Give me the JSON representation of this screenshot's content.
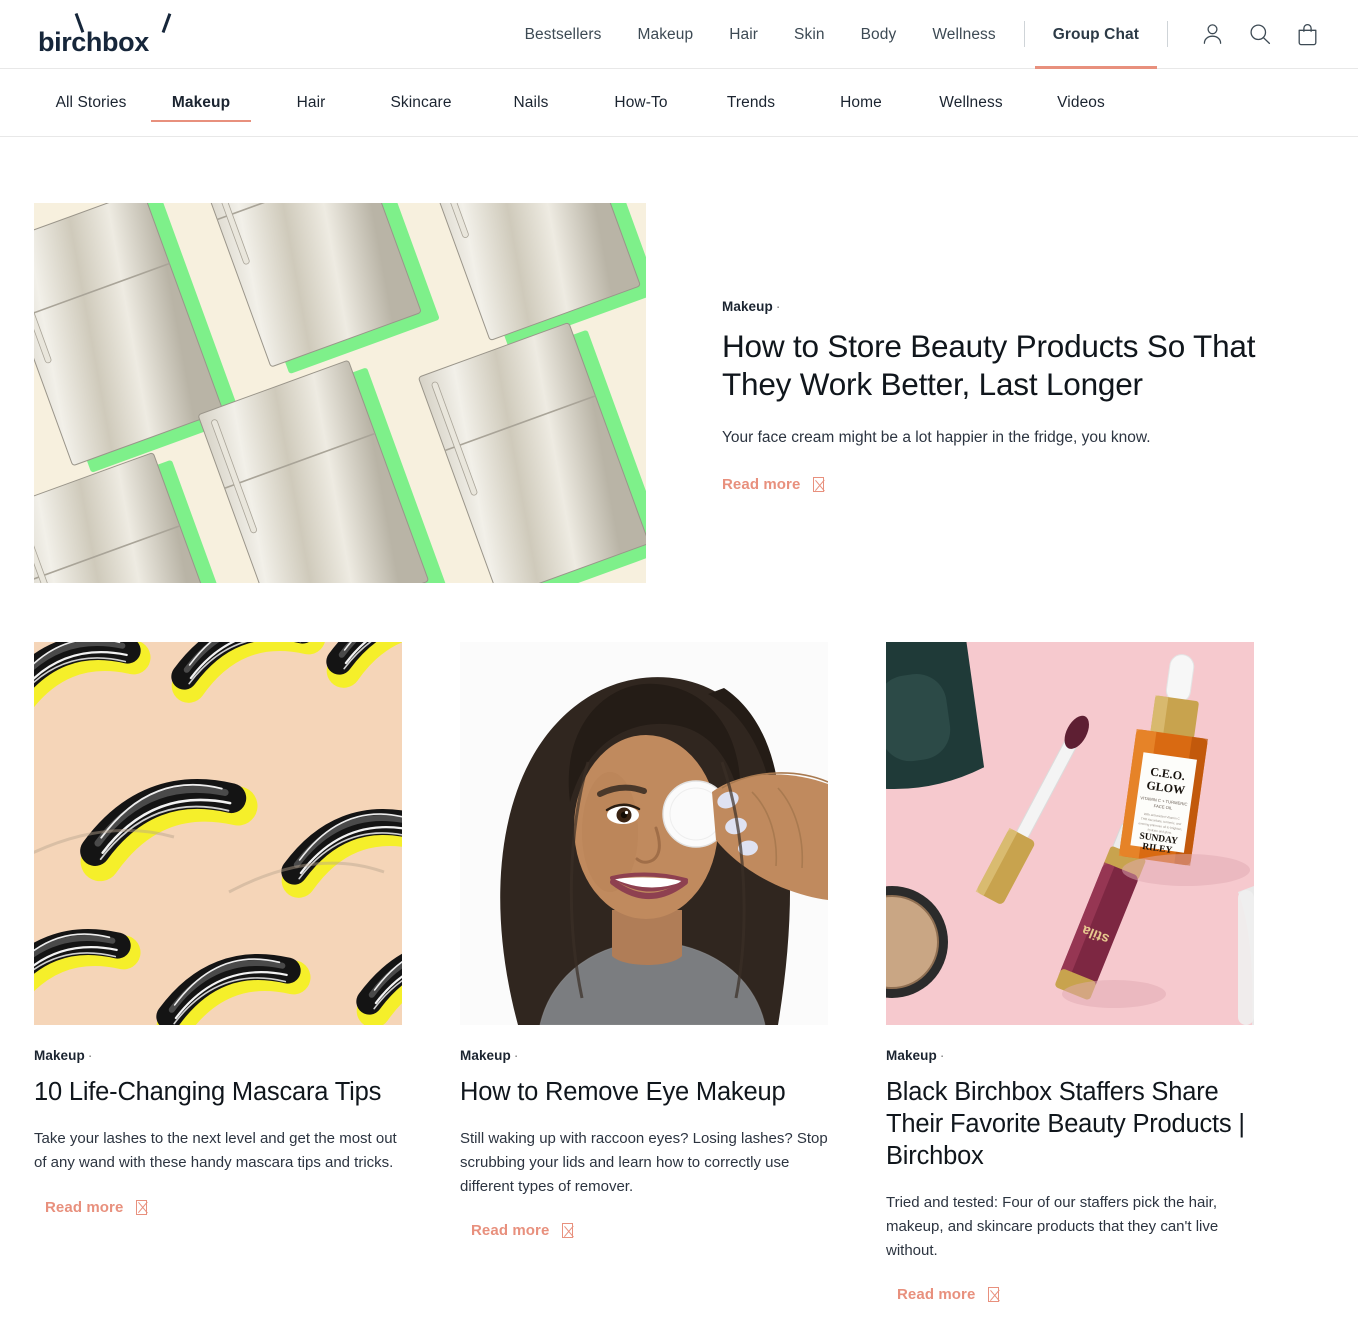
{
  "header": {
    "logo_text": "birchbox",
    "nav": [
      {
        "label": "Bestsellers",
        "active": false
      },
      {
        "label": "Makeup",
        "active": false
      },
      {
        "label": "Hair",
        "active": false
      },
      {
        "label": "Skin",
        "active": false
      },
      {
        "label": "Body",
        "active": false
      },
      {
        "label": "Wellness",
        "active": false
      },
      {
        "label": "Group Chat",
        "active": true
      }
    ],
    "icons": [
      "account-icon",
      "search-icon",
      "bag-icon"
    ]
  },
  "sub_nav": {
    "items": [
      {
        "label": "All Stories",
        "active": false
      },
      {
        "label": "Makeup",
        "active": true
      },
      {
        "label": "Hair",
        "active": false
      },
      {
        "label": "Skincare",
        "active": false
      },
      {
        "label": "Nails",
        "active": false
      },
      {
        "label": "How-To",
        "active": false
      },
      {
        "label": "Trends",
        "active": false
      },
      {
        "label": "Home",
        "active": false
      },
      {
        "label": "Wellness",
        "active": false
      },
      {
        "label": "Videos",
        "active": false
      }
    ]
  },
  "featured": {
    "category": "Makeup",
    "separator": "·",
    "title": "How to Store Beauty Products So That They Work Better, Last Longer",
    "description": "Your face cream might be a lot happier in the fridge, you know.",
    "read_more": "Read more",
    "image_alt": "stainless-steel refrigerators illustration on cream background with green shadows"
  },
  "cards": [
    {
      "category": "Makeup",
      "separator": "·",
      "title": "10 Life-Changing Mascara Tips",
      "description": "Take your lashes to the next level and get the most out of any wand with these handy mascara tips and tricks.",
      "read_more": "Read more",
      "image_alt": "black mascara brush strokes with yellow accents on peach background"
    },
    {
      "category": "Makeup",
      "separator": "·",
      "title": "How to Remove Eye Makeup",
      "description": "Still waking up with raccoon eyes? Losing lashes? Stop scrubbing your lids and learn how to correctly use different types of remover.",
      "read_more": "Read more",
      "image_alt": "smiling woman in gray sweater holding a white cotton pad over her eye"
    },
    {
      "category": "Makeup",
      "separator": "·",
      "title": "Black Birchbox Staffers Share Their Favorite Beauty Products | Birchbox",
      "description": "Tried and tested: Four of our staffers pick the hair, makeup, and skincare products that they can't live without.",
      "read_more": "Read more",
      "image_alt": "beauty products on pink background: dark pouch, gold lip gloss, Sunday Riley C.E.O. Glow face oil"
    }
  ],
  "product_labels": {
    "oil_line1": "C.E.O.",
    "oil_line2": "GLOW",
    "oil_sub": "VITAMIN C + TURMERIC FACE OIL",
    "oil_brand1": "SUNDAY",
    "oil_brand2": "RILEY",
    "gloss_brand": "stila"
  },
  "colors": {
    "accent": "#e8907d",
    "logo": "#16263a",
    "text": "#10161c",
    "body_text": "#2c3440",
    "featured_bg": "#f7f0de",
    "featured_shadow": "#7ef08a",
    "mascara_bg": "#f5d5b8",
    "mascara_accent": "#f5ef2a",
    "products_bg": "#f6c9ce"
  }
}
